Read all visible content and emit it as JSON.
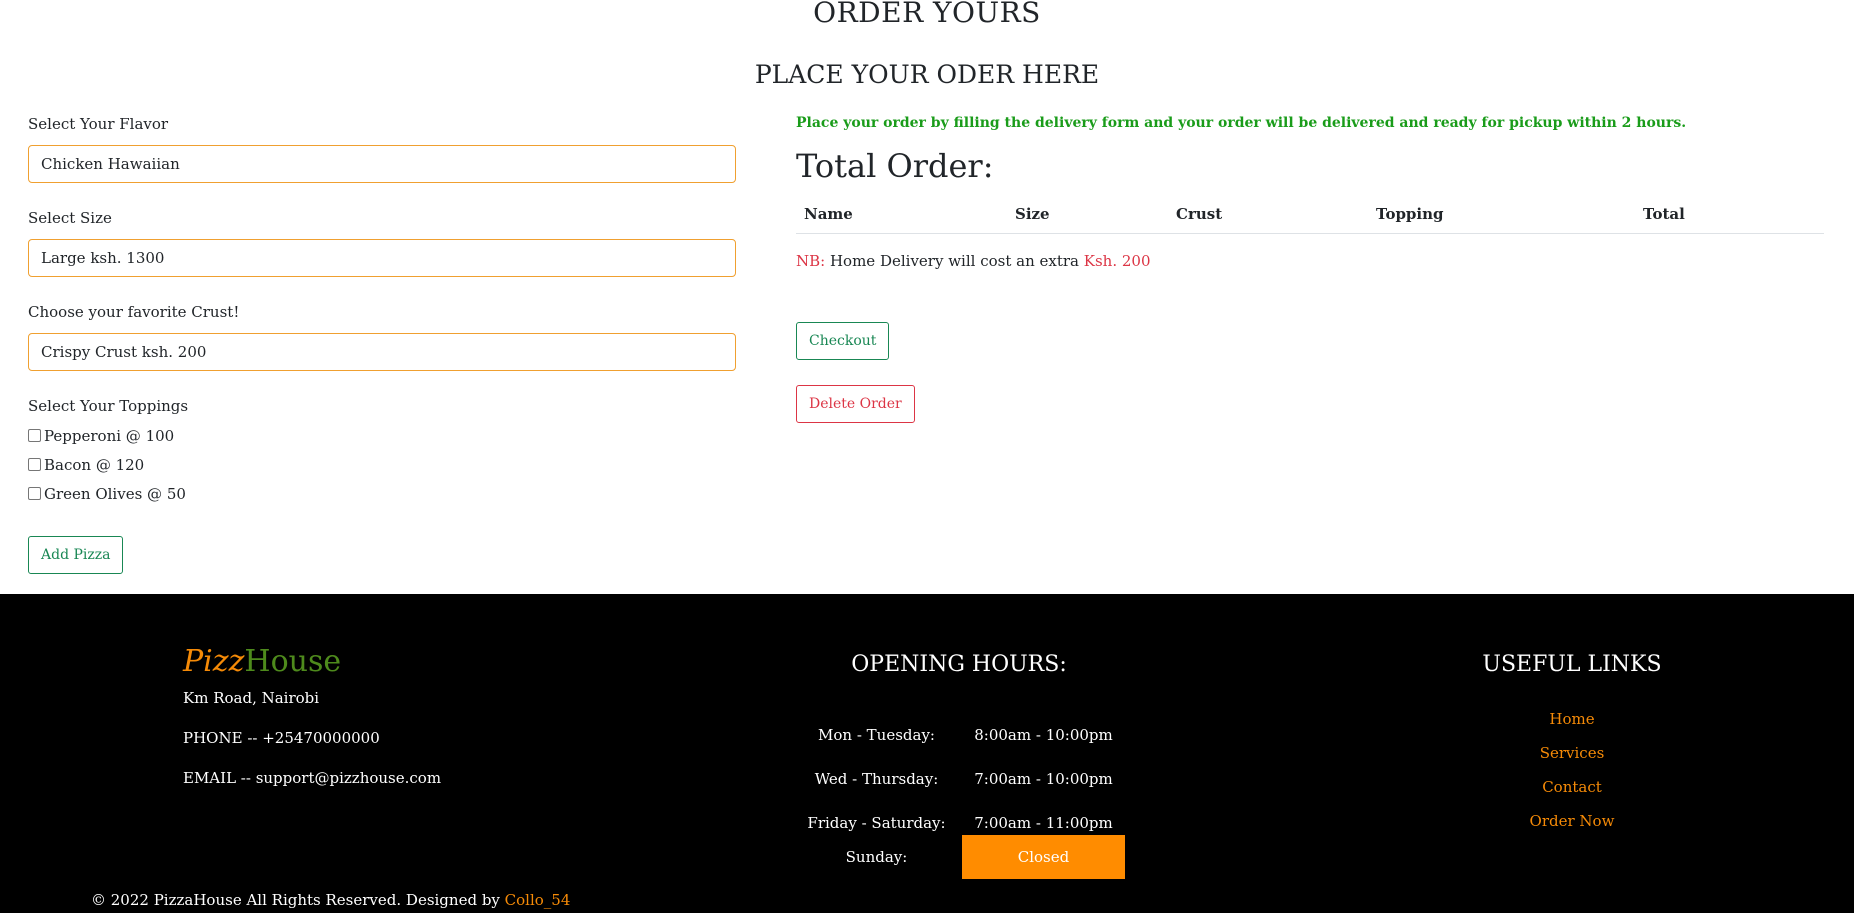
{
  "page": {
    "title": "ORDER YOURS",
    "subtitle": "PLACE YOUR ODER HERE"
  },
  "form": {
    "flavor_label": "Select Your Flavor",
    "flavor_value": "Chicken Hawaiian",
    "size_label": "Select Size",
    "size_value": "Large ksh. 1300",
    "crust_label": "Choose your favorite Crust!",
    "crust_value": "Crispy Crust ksh. 200",
    "toppings_label": "Select Your Toppings",
    "toppings": [
      {
        "label": "Pepperoni @ 100",
        "checked": false
      },
      {
        "label": "Bacon @ 120",
        "checked": false
      },
      {
        "label": "Green Olives @ 50",
        "checked": false
      }
    ],
    "add_button": "Add Pizza"
  },
  "order": {
    "notice": "Place your order by filling the delivery form and your order will be delivered and ready for pickup within 2 hours.",
    "total_title": "Total Order:",
    "columns": [
      "Name",
      "Size",
      "Crust",
      "Topping",
      "Total"
    ],
    "nb_prefix": "NB:",
    "nb_text": " Home Delivery will cost an extra ",
    "nb_amount": "Ksh. 200",
    "checkout_button": "Checkout",
    "delete_button": "Delete Order"
  },
  "footer": {
    "brand_part1": "Pizz",
    "brand_part2": "House",
    "address": "Km Road, Nairobi",
    "phone": "PHONE -- +25470000000",
    "email": "EMAIL -- support@pizzhouse.com",
    "hours_title": "OPENING HOURS:",
    "hours": [
      {
        "day": "Mon - Tuesday:",
        "time": "8:00am - 10:00pm"
      },
      {
        "day": "Wed - Thursday:",
        "time": "7:00am - 10:00pm"
      },
      {
        "day": "Friday - Saturday:",
        "time": "7:00am - 11:00pm"
      },
      {
        "day": "Sunday:",
        "time": "Closed"
      }
    ],
    "links_title": "USEFUL LINKS",
    "links": [
      "Home",
      "Services",
      "Contact",
      "Order Now"
    ],
    "copyright_text": "© 2022 PizzaHouse All Rights Reserved. Designed by ",
    "copyright_author": "Collo_54"
  },
  "colors": {
    "accent_orange": "#f58a07",
    "closed_badge": "#ff8c00",
    "brand_green": "#4e8a1c",
    "notice_green": "#1a9c1a",
    "danger_red": "#dc3545",
    "success_green": "#198754",
    "input_border": "#f0a030"
  }
}
